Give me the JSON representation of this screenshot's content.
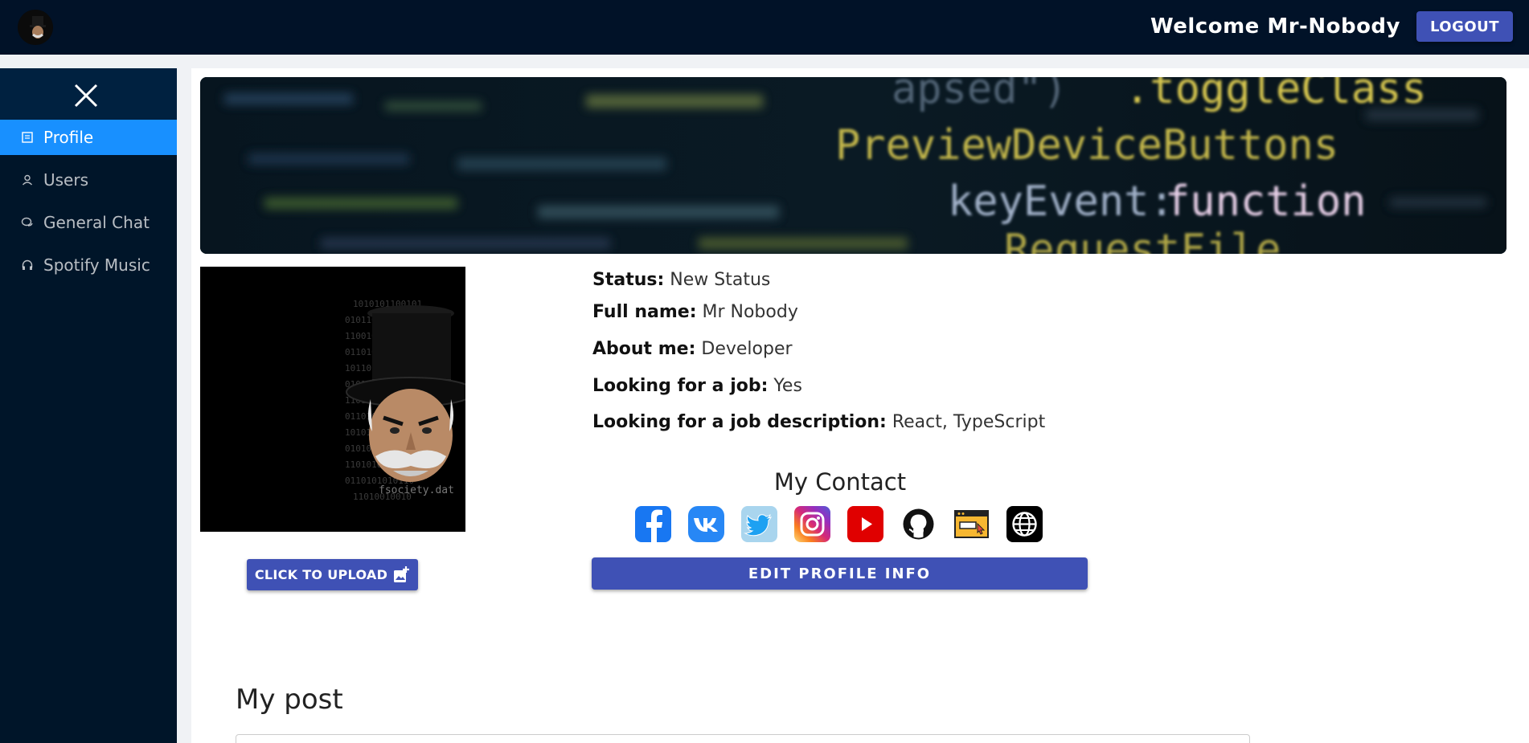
{
  "header": {
    "welcome_text": "Welcome Mr-Nobody",
    "logout_label": "LOGOUT"
  },
  "sidebar": {
    "items": [
      {
        "label": "Profile",
        "icon": "profile-icon",
        "active": true
      },
      {
        "label": "Users",
        "icon": "user-icon",
        "active": false
      },
      {
        "label": "General Chat",
        "icon": "chat-icon",
        "active": false
      },
      {
        "label": "Spotify Music",
        "icon": "headphones-icon",
        "active": false
      }
    ]
  },
  "banner": {
    "code_lines": [
      ").toggleClass",
      "PreviewDeviceButtons",
      "keyEvent:function",
      "RequestFile"
    ]
  },
  "profile": {
    "photo_caption": "fsociety.dat",
    "upload_label": "CLICK TO UPLOAD",
    "status_label": "Status:",
    "status_value": "New Status",
    "fullname_label": "Full name:",
    "fullname_value": "Mr Nobody",
    "about_label": "About me:",
    "about_value": "Developer",
    "job_label": "Looking for a job:",
    "job_value": "Yes",
    "job_desc_label": "Looking for a job description:",
    "job_desc_value": "React, TypeScript",
    "contact_title": "My Contact",
    "socials": [
      "facebook-icon",
      "vk-icon",
      "twitter-icon",
      "instagram-icon",
      "youtube-icon",
      "github-icon",
      "website-icon",
      "globe-icon"
    ],
    "edit_label": "EDIT PROFILE INFO"
  },
  "posts": {
    "title": "My post"
  },
  "colors": {
    "header_bg": "#011228",
    "sidebar_bg": "#001529",
    "active_item": "#1890ff",
    "button": "#3f51b5"
  }
}
